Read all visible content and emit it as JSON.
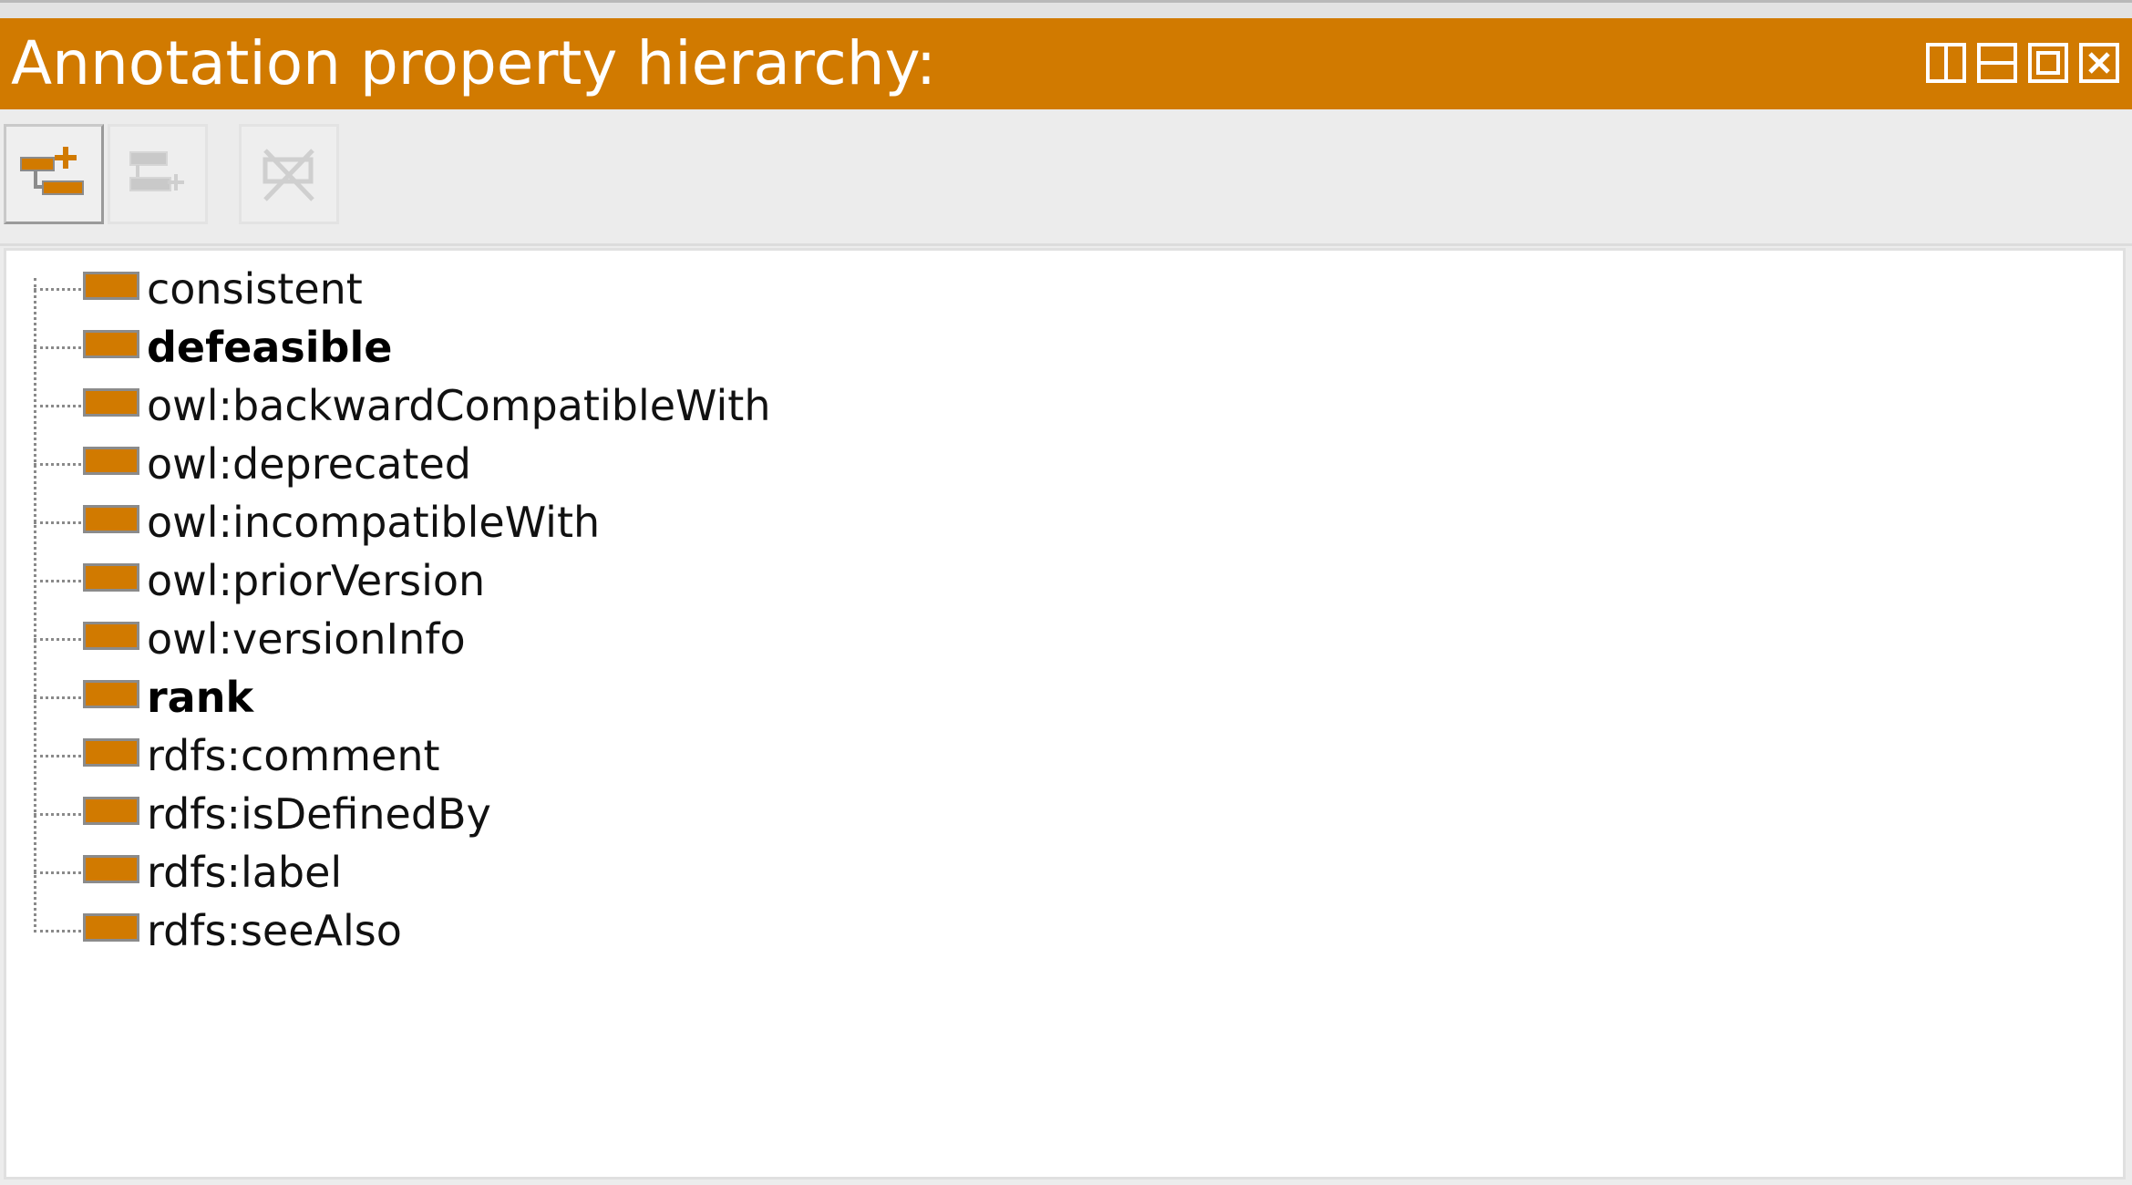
{
  "window": {
    "title": "Annotation property hierarchy:",
    "controls": [
      {
        "name": "split-vertical-icon"
      },
      {
        "name": "split-horizontal-icon"
      },
      {
        "name": "maximize-icon"
      },
      {
        "name": "close-icon"
      }
    ]
  },
  "toolbar": {
    "buttons": [
      {
        "name": "add-sub-property-button",
        "icon": "add-subproperty-icon",
        "enabled": true
      },
      {
        "name": "add-sibling-property-button",
        "icon": "add-sibling-icon",
        "enabled": false
      },
      {
        "name": "delete-property-button",
        "icon": "delete-property-icon",
        "enabled": false
      }
    ]
  },
  "colors": {
    "accent": "#d17a00",
    "icon_border": "#8b8b8b",
    "toolbar_bg": "#ececec"
  },
  "tree": {
    "items": [
      {
        "label": "consistent",
        "bold": false
      },
      {
        "label": "defeasible",
        "bold": true
      },
      {
        "label": "owl:backwardCompatibleWith",
        "bold": false
      },
      {
        "label": "owl:deprecated",
        "bold": false
      },
      {
        "label": "owl:incompatibleWith",
        "bold": false
      },
      {
        "label": "owl:priorVersion",
        "bold": false
      },
      {
        "label": "owl:versionInfo",
        "bold": false
      },
      {
        "label": "rank",
        "bold": true
      },
      {
        "label": "rdfs:comment",
        "bold": false
      },
      {
        "label": "rdfs:isDefinedBy",
        "bold": false
      },
      {
        "label": "rdfs:label",
        "bold": false
      },
      {
        "label": "rdfs:seeAlso",
        "bold": false
      }
    ]
  }
}
